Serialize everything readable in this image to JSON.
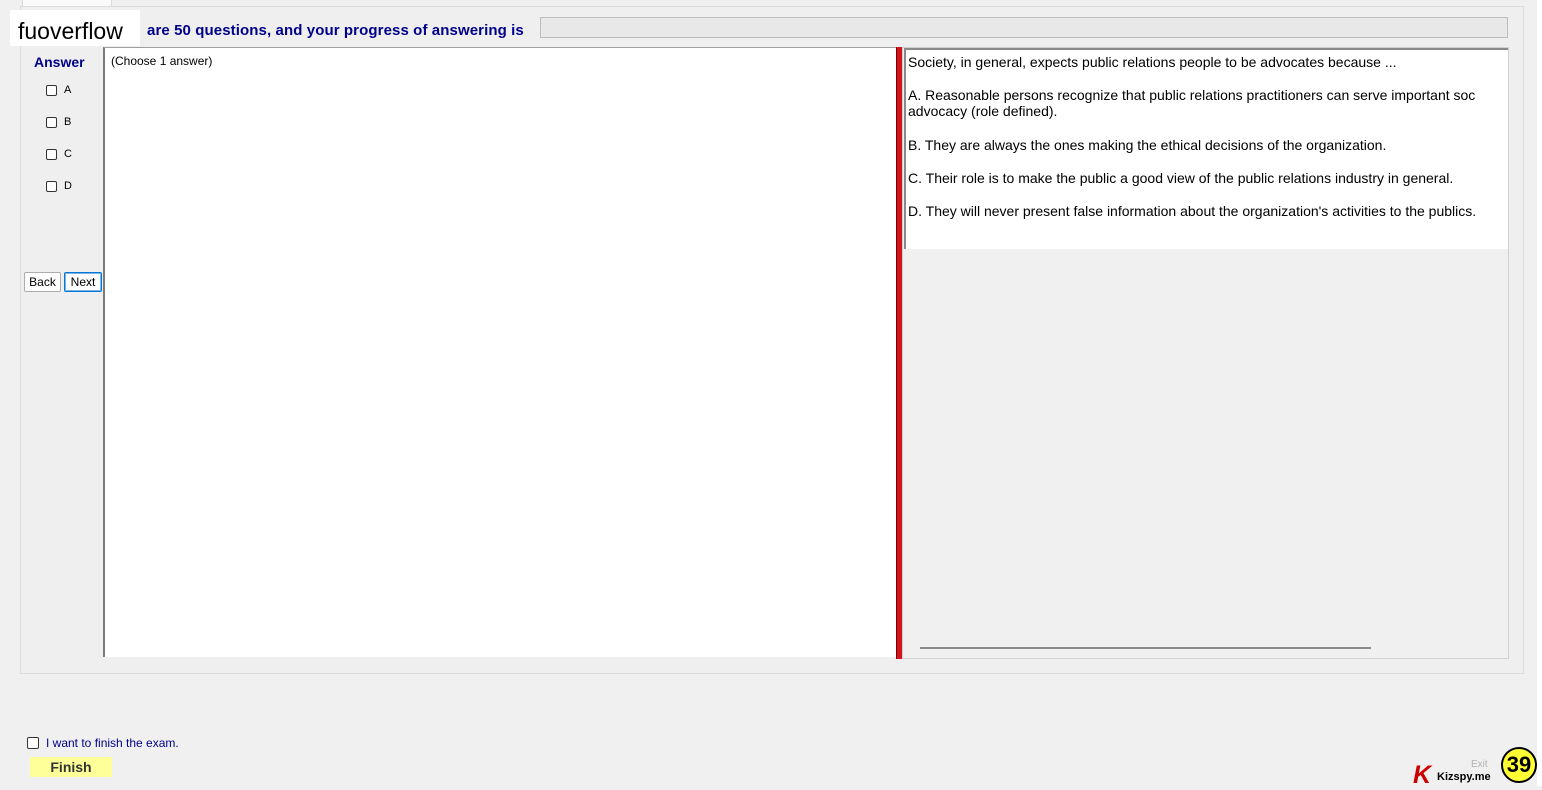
{
  "app": {
    "brand": "fuoverflow",
    "progress_text": "are 50 questions, and your progress of answering is",
    "progress_fraction": 0
  },
  "answer_panel": {
    "title": "Answer",
    "options": [
      {
        "label": "A",
        "checked": false
      },
      {
        "label": "B",
        "checked": false
      },
      {
        "label": "C",
        "checked": false
      },
      {
        "label": "D",
        "checked": false
      }
    ],
    "back_label": "Back",
    "next_label": "Next"
  },
  "main": {
    "instruction": "(Choose 1 answer)"
  },
  "question": {
    "stem": "Society, in general, expects public relations people to be advocates because ...",
    "choices": [
      {
        "text_line1": "A.  Reasonable persons recognize that public relations practitioners can serve important soc",
        "text_line2": "advocacy (role defined)."
      },
      {
        "text_line1": "B.  They are always the ones making the ethical decisions of the organization.",
        "text_line2": ""
      },
      {
        "text_line1": "C.  Their role is to make the public a good view of the public relations industry in general.",
        "text_line2": ""
      },
      {
        "text_line1": "D.  They will never present false information about the organization's activities to the publics.",
        "text_line2": ""
      }
    ]
  },
  "footer": {
    "finish_checkbox_label": "I want to finish the exam.",
    "finish_label": "Finish",
    "exit_label": "Exit",
    "watermark_text": "Kizspy.me",
    "watermark_letter": "K",
    "question_number": "39"
  },
  "colors": {
    "accent_blue": "#00008b",
    "divider_red": "#d2161c",
    "finish_yellow": "#ffff99",
    "badge_yellow": "#ffff33"
  }
}
